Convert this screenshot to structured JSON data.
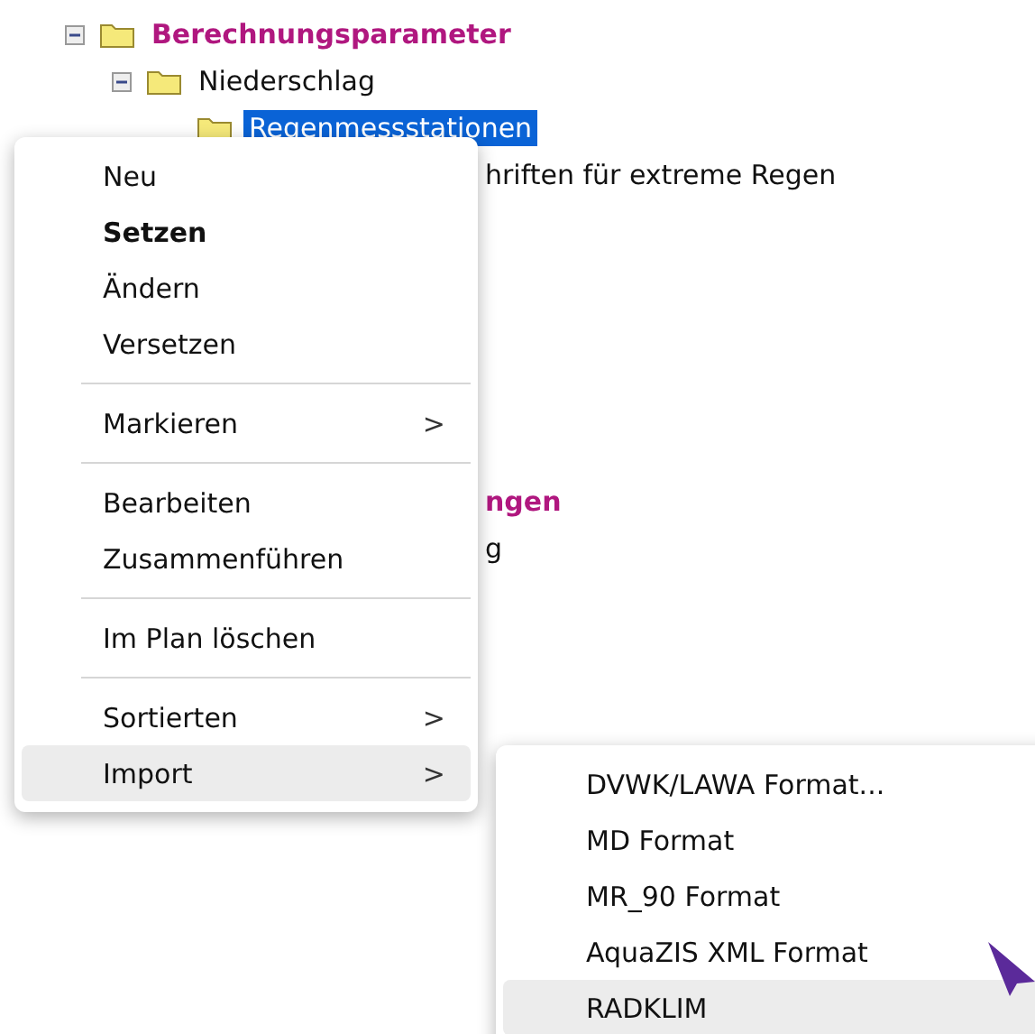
{
  "tree": [
    {
      "label": "Berechnungsparameter",
      "kind": "group",
      "expanded": true,
      "selected": false,
      "children": [
        {
          "label": "Niederschlag",
          "kind": "folder",
          "expanded": true,
          "selected": false,
          "children": [
            {
              "label": "Regenmessstationen",
              "kind": "folder",
              "selected": true
            }
          ]
        }
      ]
    }
  ],
  "obscured_labels": [
    {
      "text": "hriften für extreme Regen",
      "kind": "plain"
    },
    {
      "text": "ngen",
      "kind": "group"
    },
    {
      "text": "g",
      "kind": "plain"
    }
  ],
  "context_menu": {
    "sections": [
      [
        {
          "label": "Neu",
          "bold": false,
          "submenu": false,
          "selected": false
        },
        {
          "label": "Setzen",
          "bold": true,
          "submenu": false,
          "selected": false
        },
        {
          "label": "Ändern",
          "bold": false,
          "submenu": false,
          "selected": false
        },
        {
          "label": "Versetzen",
          "bold": false,
          "submenu": false,
          "selected": false
        }
      ],
      [
        {
          "label": "Markieren",
          "bold": false,
          "submenu": true,
          "selected": false
        }
      ],
      [
        {
          "label": "Bearbeiten",
          "bold": false,
          "submenu": false,
          "selected": false
        },
        {
          "label": "Zusammenführen",
          "bold": false,
          "submenu": false,
          "selected": false
        }
      ],
      [
        {
          "label": "Im Plan löschen",
          "bold": false,
          "submenu": false,
          "selected": false
        }
      ],
      [
        {
          "label": "Sortierten",
          "bold": false,
          "submenu": true,
          "selected": false
        },
        {
          "label": "Import",
          "bold": false,
          "submenu": true,
          "selected": true
        }
      ]
    ]
  },
  "submenu": {
    "items": [
      {
        "label": "DVWK/LAWA Format...",
        "selected": false
      },
      {
        "label": "MD Format",
        "selected": false
      },
      {
        "label": "MR_90 Format",
        "selected": false
      },
      {
        "label": "AquaZIS XML Format",
        "selected": false
      },
      {
        "label": "RADKLIM",
        "selected": true
      }
    ]
  },
  "arrow_glyph": ">"
}
